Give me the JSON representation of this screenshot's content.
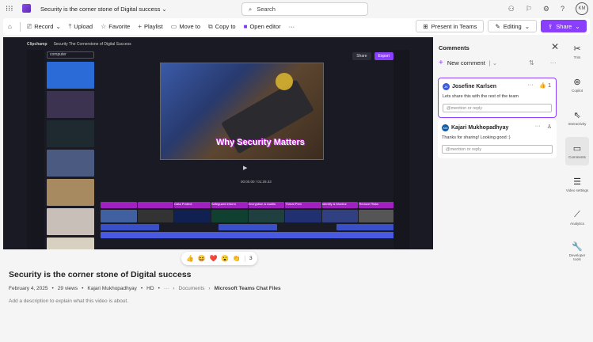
{
  "header": {
    "title": "Security is the corner stone of Digital success",
    "search_placeholder": "Search",
    "avatar": "KM"
  },
  "toolbar": {
    "record": "Record",
    "upload": "Upload",
    "favorite": "Favorite",
    "playlist": "Playlist",
    "move_to": "Move to",
    "copy_to": "Copy to",
    "open_editor": "Open editor",
    "more": "···",
    "present": "Present in Teams",
    "editing": "Editing",
    "share": "Share"
  },
  "editor": {
    "app": "Clipchamp",
    "project": "Security The Cornerstone of Digital Success",
    "search": "computer",
    "share": "Share",
    "export": "Export",
    "caption": "Why Security Matters",
    "timecode": "00:00.00 / 01:29.33",
    "clips": [
      "Data Protect",
      "Safeguard Inform",
      "Encryption & Audits",
      "Threat Prev",
      "Identify & Monitor",
      "Reduce Risks"
    ]
  },
  "reactions": {
    "emojis": [
      "👍",
      "😆",
      "❤️",
      "😮",
      "👏"
    ],
    "count": "3"
  },
  "video": {
    "title": "Security is the corner stone of Digital success",
    "date": "February 4, 2025",
    "views": "29 views",
    "owner": "Kajari Mukhopadhyay",
    "quality": "HD",
    "path_more": "···",
    "folder": "Documents",
    "location": "Microsoft Teams Chat Files",
    "description_placeholder": "Add a description to explain what this video is about."
  },
  "comments": {
    "title": "Comments",
    "new_comment": "New comment",
    "items": [
      {
        "initials": "JK",
        "author": "Josefine Karlsen",
        "text": "Lets share this with the rest of the team",
        "likes": "1",
        "reply_placeholder": "@mention or reply"
      },
      {
        "initials": "KM",
        "author": "Kajari Mukhopadhyay",
        "text": "Thanks for sharing! Looking good :)",
        "reply_placeholder": "@mention or reply"
      }
    ]
  },
  "rail": [
    "Trim",
    "Copilot",
    "Interactivity",
    "Comments",
    "Video settings",
    "Analytics",
    "Developer tools"
  ]
}
